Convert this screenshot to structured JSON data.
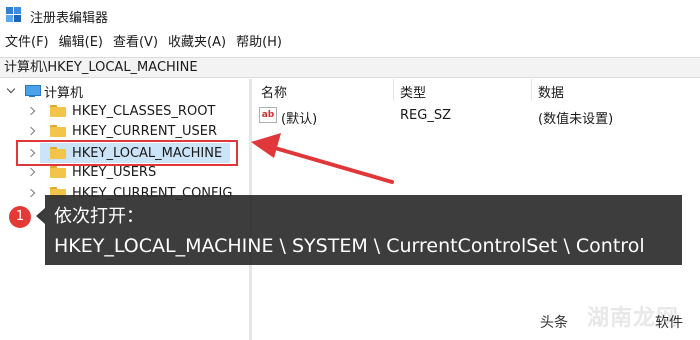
{
  "window": {
    "title": "注册表编辑器"
  },
  "menu": [
    "文件(F)",
    "编辑(E)",
    "查看(V)",
    "收藏夹(A)",
    "帮助(H)"
  ],
  "address": "计算机\\HKEY_LOCAL_MACHINE",
  "tree": {
    "root": "计算机",
    "items": [
      "HKEY_CLASSES_ROOT",
      "HKEY_CURRENT_USER",
      "HKEY_LOCAL_MACHINE",
      "HKEY_USERS",
      "HKEY_CURRENT_CONFIG"
    ],
    "selected": "HKEY_LOCAL_MACHINE"
  },
  "list": {
    "columns": [
      "名称",
      "类型",
      "数据"
    ],
    "rows": [
      {
        "icon": "ab",
        "name": "(默认)",
        "type": "REG_SZ",
        "data": "(数值未设置)"
      }
    ]
  },
  "tooltip": {
    "badge": "1",
    "line1": "依次打开：",
    "line2": "HKEY_LOCAL_MACHINE \\ SYSTEM \\ CurrentControlSet \\ Control"
  },
  "watermark": {
    "prefix": "头条",
    "brand": "湖南龙网",
    "suffix": "软件"
  },
  "colors": {
    "highlight": "#e0383a",
    "badge": "#e53935",
    "tooltip_bg": "#2d2d2d",
    "selection": "#cce4f7"
  }
}
